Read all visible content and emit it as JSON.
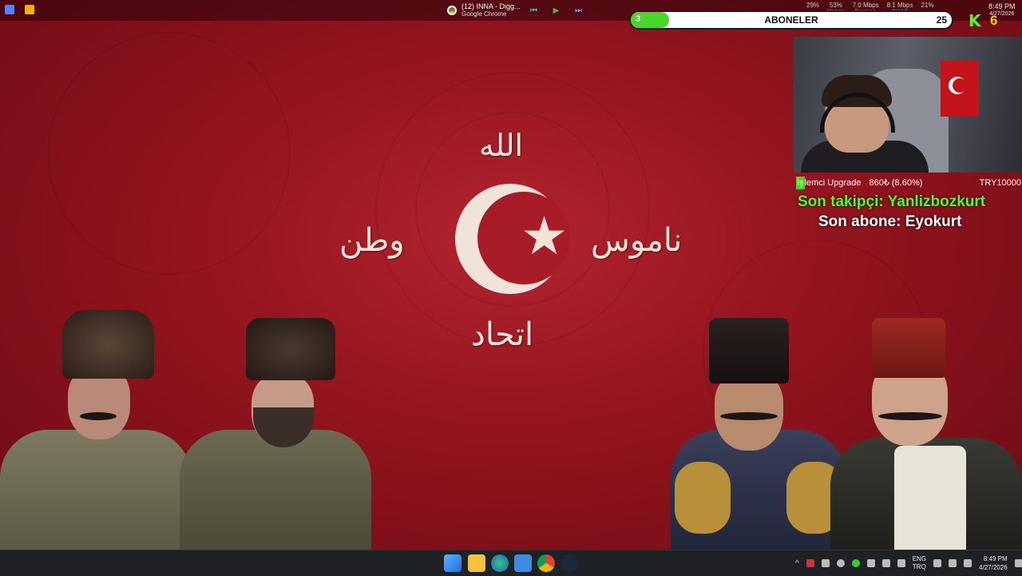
{
  "topbar": {
    "media": {
      "title": "(12) INNA - Digg...",
      "app": "Google Chrome"
    },
    "stats": [
      {
        "value": "29%",
        "label": ""
      },
      {
        "value": "53%",
        "label": "Memory"
      },
      {
        "value": "7.0 Mbps",
        "label": "Receive L"
      },
      {
        "value": "8.1 Mbps",
        "label": "Send S"
      },
      {
        "value": "21%",
        "label": ""
      }
    ],
    "time": "8:49 PM",
    "date": "4/27/2026"
  },
  "subscriber_bar": {
    "current": "3",
    "label": "ABONELER",
    "goal": "25",
    "progress_fraction": 0.12,
    "accent": "#4bd42a"
  },
  "kick": {
    "logo": "K",
    "count": "6",
    "brand_color": "#53fc18"
  },
  "donation": {
    "label_highlight": "İş",
    "label_rest": "lemci Upgrade",
    "amount": "860₺ (8.60%)",
    "goal": "TRY10000"
  },
  "last_follower": {
    "label": "Son takipçi:",
    "name": "Yanlizbozkurt"
  },
  "last_subscriber": {
    "label": "Son abone:",
    "name": "Eyokurt"
  },
  "wallpaper": {
    "top_word": "الله",
    "left_word": "وطن",
    "right_word": "ناموس",
    "bottom_word": "اتحاد",
    "star": "★"
  },
  "taskbar": {
    "apps": [
      "start-icon",
      "file-explorer-icon",
      "edge-icon",
      "store-icon",
      "chrome-icon",
      "steam-icon"
    ],
    "lang_top": "ENG",
    "lang_bottom": "TRQ",
    "time": "8:49 PM",
    "date": "4/27/2026",
    "tray_chevron": "^"
  }
}
